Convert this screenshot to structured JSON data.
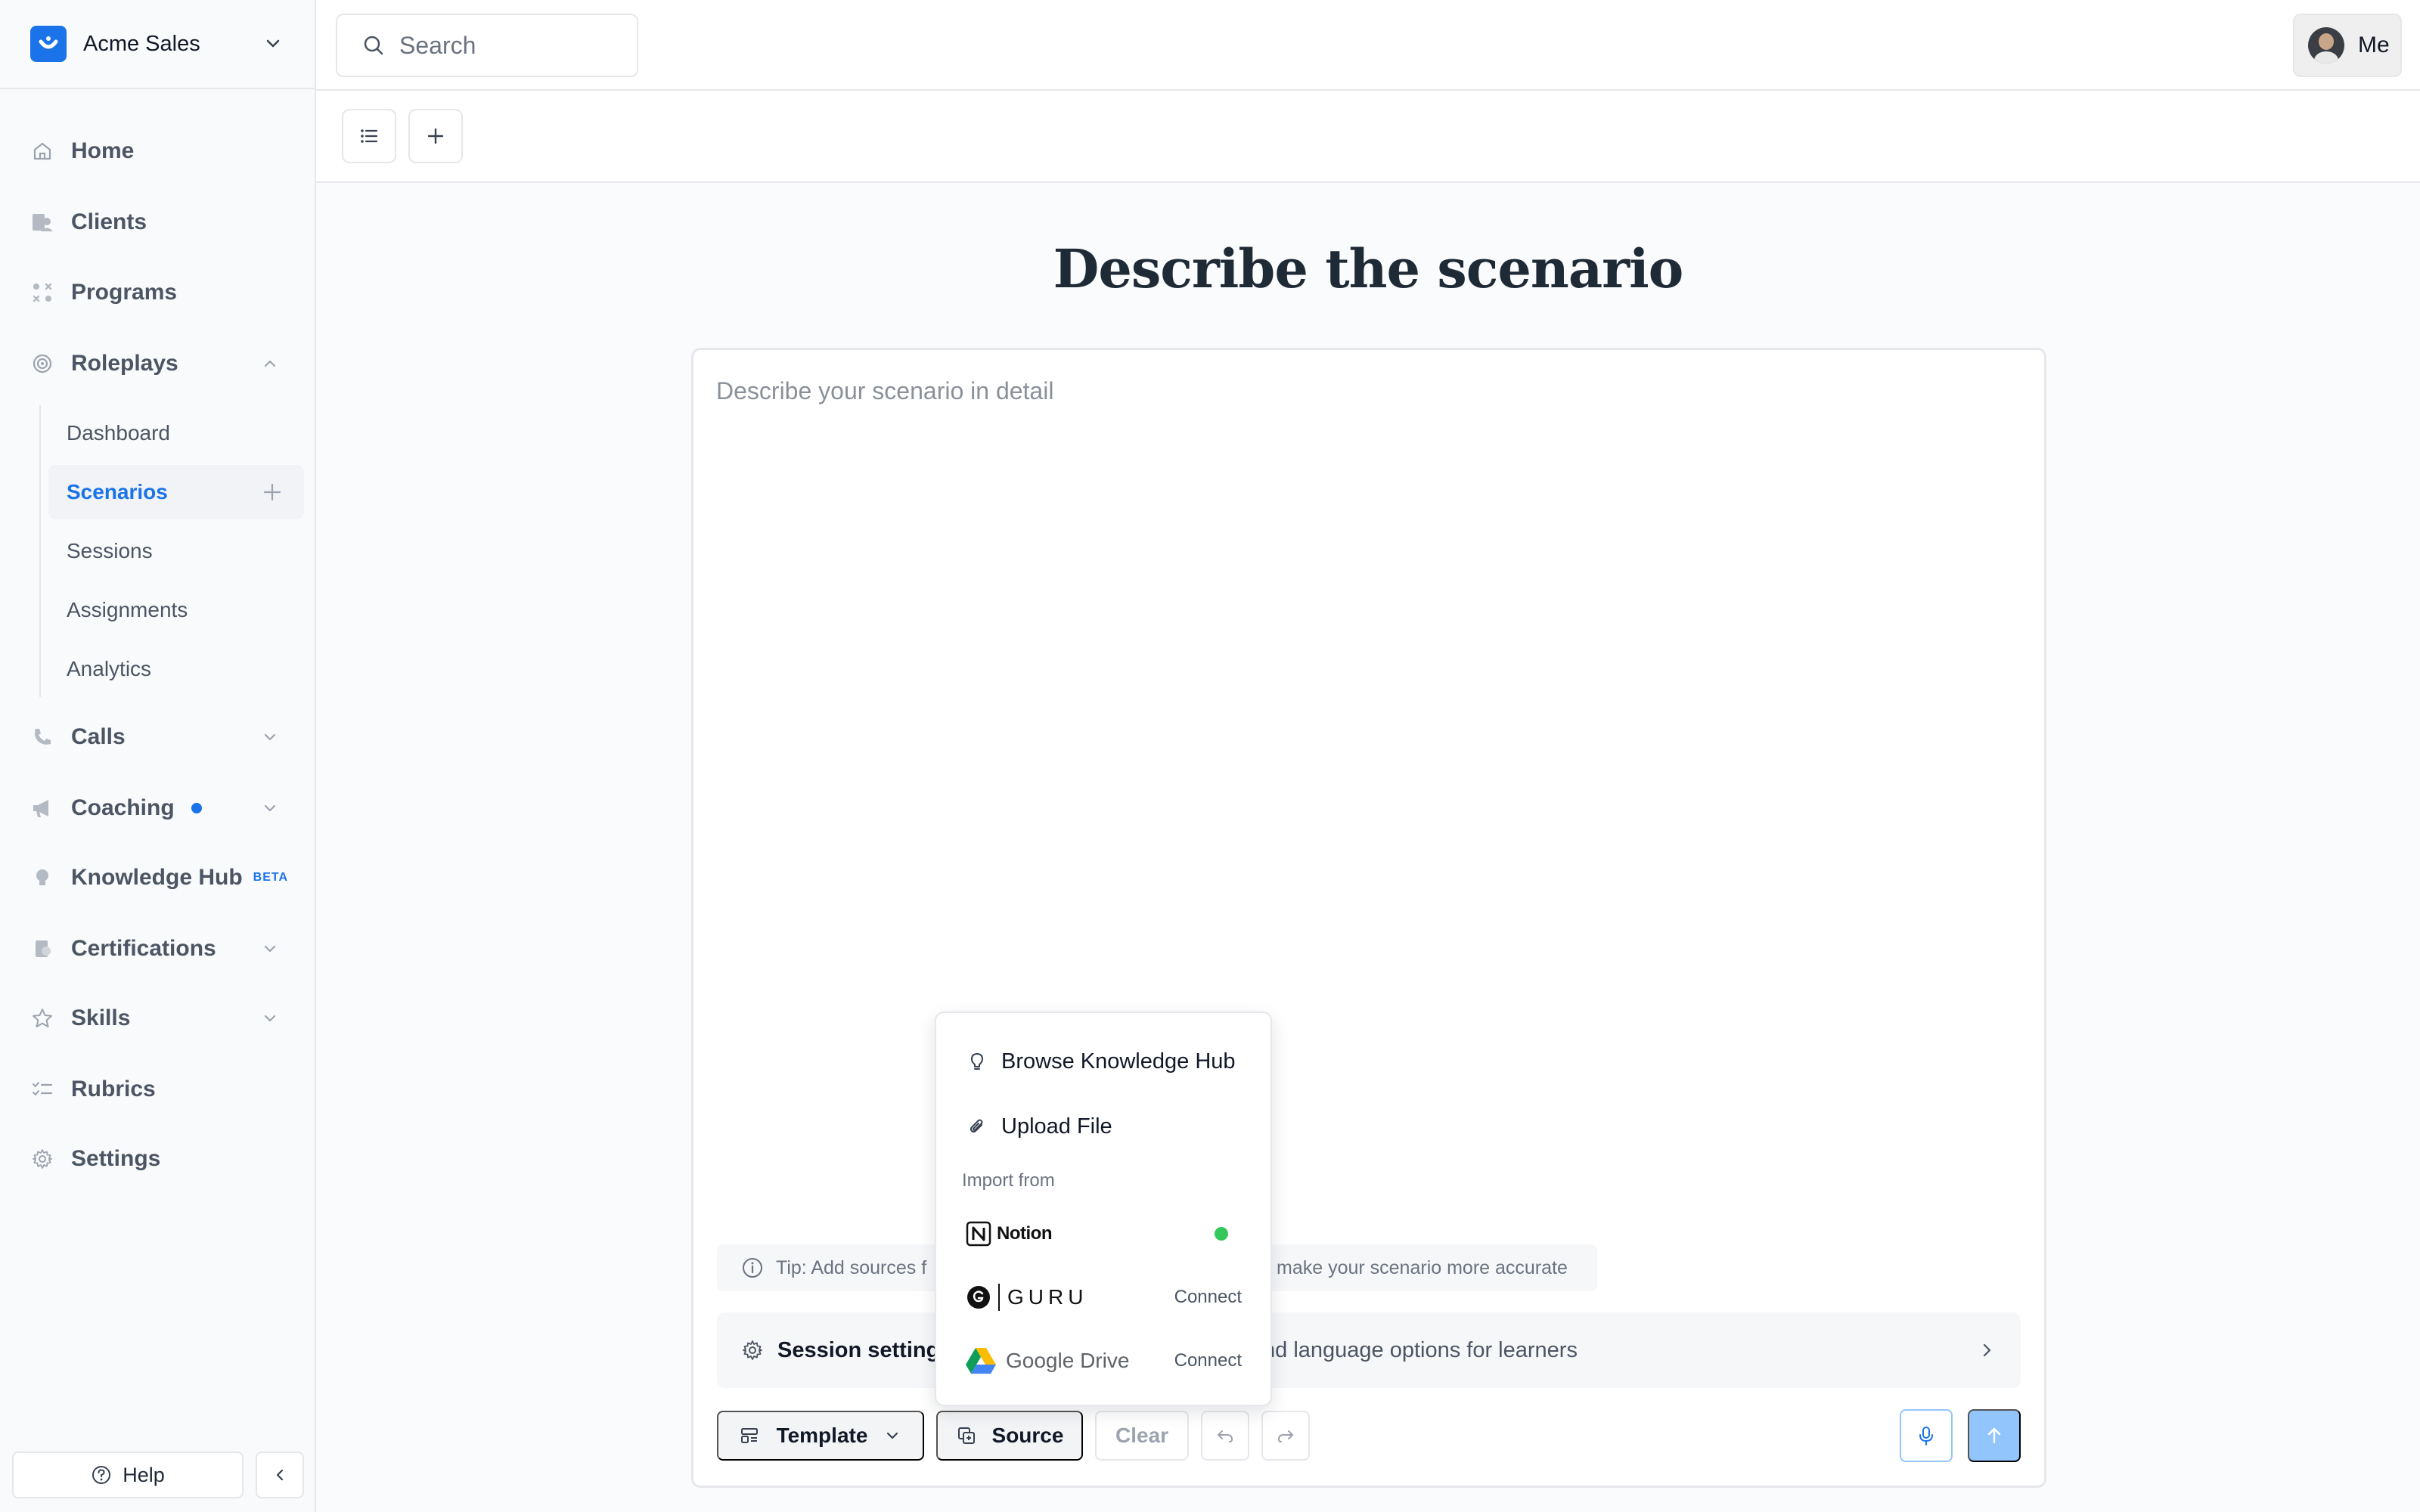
{
  "workspace": {
    "name": "Acme Sales",
    "logo_color": "#1a73e8"
  },
  "search": {
    "placeholder": "Search"
  },
  "user": {
    "label": "Me"
  },
  "nav": {
    "home": "Home",
    "clients": "Clients",
    "programs": "Programs",
    "roleplays": "Roleplays",
    "roleplays_sub": {
      "dashboard": "Dashboard",
      "scenarios": "Scenarios",
      "sessions": "Sessions",
      "assignments": "Assignments",
      "analytics": "Analytics"
    },
    "calls": "Calls",
    "coaching": "Coaching",
    "knowledge_hub": "Knowledge Hub",
    "knowledge_hub_badge": "BETA",
    "certifications": "Certifications",
    "skills": "Skills",
    "rubrics": "Rubrics",
    "settings": "Settings"
  },
  "footer": {
    "help": "Help"
  },
  "main": {
    "heading": "Describe the scenario",
    "editor_placeholder": "Describe your scenario in detail",
    "tip_left": "Tip: Add sources f",
    "tip_right": "make your scenario more accurate",
    "session_title": "Session setting",
    "session_desc": "nd language options for learners",
    "buttons": {
      "template": "Template",
      "source": "Source",
      "clear": "Clear"
    }
  },
  "source_menu": {
    "browse": "Browse Knowledge Hub",
    "upload": "Upload File",
    "import_from": "Import from",
    "notion": {
      "name": "Notion",
      "status": "connected"
    },
    "guru": {
      "name": "GURU",
      "action": "Connect"
    },
    "gdrive": {
      "name": "Google Drive",
      "action": "Connect"
    }
  },
  "colors": {
    "accent": "#1a73e8",
    "send_button": "#93c5fd",
    "connected_dot": "#34c759"
  }
}
